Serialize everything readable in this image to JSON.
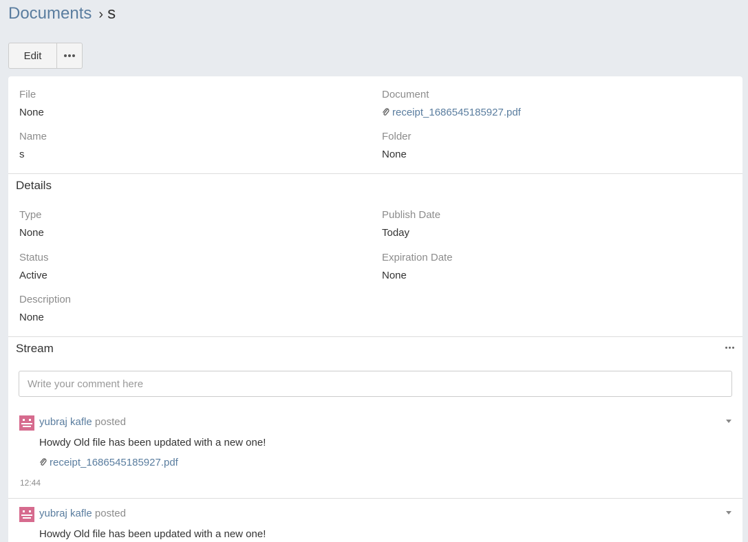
{
  "breadcrumb": {
    "parent": "Documents",
    "separator": "›",
    "current": "s"
  },
  "toolbar": {
    "edit_label": "Edit",
    "more_icon": "dots-horizontal-icon"
  },
  "overview": {
    "file": {
      "label": "File",
      "value": "None"
    },
    "document": {
      "label": "Document",
      "value": "receipt_1686545185927.pdf",
      "icon": "paperclip-icon"
    },
    "name": {
      "label": "Name",
      "value": "s"
    },
    "folder": {
      "label": "Folder",
      "value": "None"
    }
  },
  "details": {
    "title": "Details",
    "type": {
      "label": "Type",
      "value": "None"
    },
    "publish_date": {
      "label": "Publish Date",
      "value": "Today"
    },
    "status": {
      "label": "Status",
      "value": "Active"
    },
    "expiration_date": {
      "label": "Expiration Date",
      "value": "None"
    },
    "description": {
      "label": "Description",
      "value": "None"
    }
  },
  "stream": {
    "title": "Stream",
    "comment_placeholder": "Write your comment here",
    "notes": [
      {
        "user": "yubraj kafle",
        "verb": "posted",
        "text": "Howdy Old file has been updated with a new one!",
        "attachment": "receipt_1686545185927.pdf",
        "time": "12:44"
      },
      {
        "user": "yubraj kafle",
        "verb": "posted",
        "text": "Howdy Old file has been updated with a new one!"
      }
    ]
  },
  "colors": {
    "background": "#e8ebef",
    "link": "#5a7d9f",
    "avatar": "#d66b8e"
  }
}
